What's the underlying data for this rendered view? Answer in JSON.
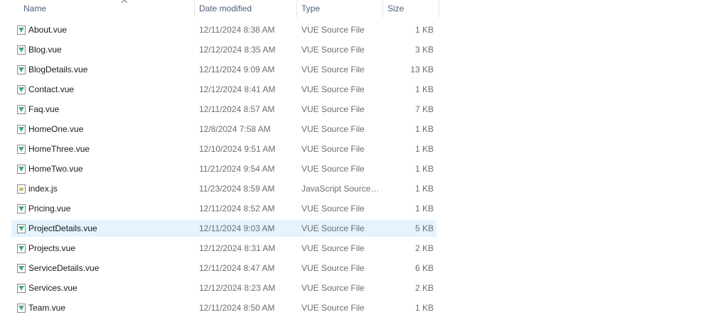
{
  "columns": {
    "name": "Name",
    "date": "Date modified",
    "type": "Type",
    "size": "Size"
  },
  "files": [
    {
      "name": "About.vue",
      "date": "12/11/2024 8:38 AM",
      "type": "VUE Source File",
      "size": "1 KB",
      "icon": "vue-file-icon"
    },
    {
      "name": "Blog.vue",
      "date": "12/12/2024 8:35 AM",
      "type": "VUE Source File",
      "size": "3 KB",
      "icon": "vue-file-icon"
    },
    {
      "name": "BlogDetails.vue",
      "date": "12/11/2024 9:09 AM",
      "type": "VUE Source File",
      "size": "13 KB",
      "icon": "vue-file-icon"
    },
    {
      "name": "Contact.vue",
      "date": "12/12/2024 8:41 AM",
      "type": "VUE Source File",
      "size": "1 KB",
      "icon": "vue-file-icon"
    },
    {
      "name": "Faq.vue",
      "date": "12/11/2024 8:57 AM",
      "type": "VUE Source File",
      "size": "7 KB",
      "icon": "vue-file-icon"
    },
    {
      "name": "HomeOne.vue",
      "date": "12/8/2024 7:58 AM",
      "type": "VUE Source File",
      "size": "1 KB",
      "icon": "vue-file-icon"
    },
    {
      "name": "HomeThree.vue",
      "date": "12/10/2024 9:51 AM",
      "type": "VUE Source File",
      "size": "1 KB",
      "icon": "vue-file-icon"
    },
    {
      "name": "HomeTwo.vue",
      "date": "11/21/2024 9:54 AM",
      "type": "VUE Source File",
      "size": "1 KB",
      "icon": "vue-file-icon"
    },
    {
      "name": "index.js",
      "date": "11/23/2024 8:59 AM",
      "type": "JavaScript Source ...",
      "size": "1 KB",
      "icon": "js-file-icon"
    },
    {
      "name": "Pricing.vue",
      "date": "12/11/2024 8:52 AM",
      "type": "VUE Source File",
      "size": "1 KB",
      "icon": "vue-file-icon"
    },
    {
      "name": "ProjectDetails.vue",
      "date": "12/11/2024 9:03 AM",
      "type": "VUE Source File",
      "size": "5 KB",
      "icon": "vue-file-icon",
      "selected": true
    },
    {
      "name": "Projects.vue",
      "date": "12/12/2024 8:31 AM",
      "type": "VUE Source File",
      "size": "2 KB",
      "icon": "vue-file-icon"
    },
    {
      "name": "ServiceDetails.vue",
      "date": "12/11/2024 8:47 AM",
      "type": "VUE Source File",
      "size": "6 KB",
      "icon": "vue-file-icon"
    },
    {
      "name": "Services.vue",
      "date": "12/12/2024 8:23 AM",
      "type": "VUE Source File",
      "size": "2 KB",
      "icon": "vue-file-icon"
    },
    {
      "name": "Team.vue",
      "date": "12/11/2024 8:50 AM",
      "type": "VUE Source File",
      "size": "1 KB",
      "icon": "vue-file-icon"
    }
  ],
  "colors": {
    "header_text": "#4c607a",
    "selection": "#e5f3ff",
    "vue_green": "#41b883",
    "vue_dark": "#35495e",
    "js_yellow": "#d7c24a"
  }
}
